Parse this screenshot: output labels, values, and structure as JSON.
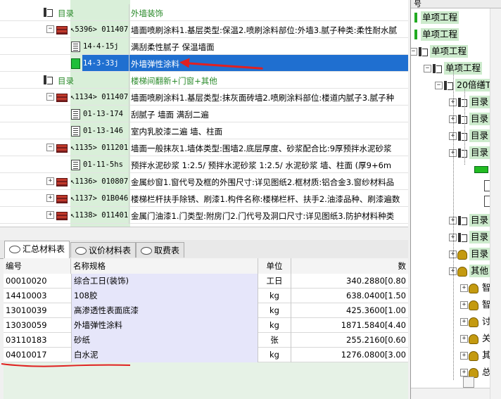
{
  "tree": {
    "rows": [
      {
        "kind": "dir",
        "expand": "",
        "code": "目录",
        "desc": "外墙装饰"
      },
      {
        "kind": "item",
        "expand": "−",
        "code": "↖5396> 011407",
        "desc": "墙面喷刷涂料1.基层类型:保温2.喷刷涂料部位:外墙3.腻子种类:柔性耐水腻"
      },
      {
        "kind": "sub",
        "code": "14-4-15j",
        "desc": "满刮柔性腻子 保温墙面"
      },
      {
        "kind": "sub",
        "code": "14-3-33j",
        "desc": "外墙弹性涂料",
        "selected": true
      },
      {
        "kind": "dir",
        "expand": "",
        "code": "目录",
        "desc": "楼梯间翻新+门窗+其他"
      },
      {
        "kind": "item",
        "expand": "−",
        "code": "↖1134> 011407",
        "desc": "墙面喷刷涂料1.基层类型:抹灰面砖墙2.喷刷涂料部位:楼道内腻子3.腻子种"
      },
      {
        "kind": "sub",
        "code": "01-13-174",
        "desc": "刮腻子 墙面 满刮二遍"
      },
      {
        "kind": "sub",
        "code": "01-13-146",
        "desc": "室内乳胶漆二遍 墙、柱面"
      },
      {
        "kind": "item",
        "expand": "−",
        "code": "↖1135> 011201",
        "desc": "墙面一般抹灰1.墙体类型:围墙2.底层厚度、砂浆配合比:9厚预拌水泥砂浆"
      },
      {
        "kind": "sub",
        "code": "01-11-5hs",
        "desc": "预拌水泥砂浆 1:2.5/ 预拌水泥砂浆 1:2.5/ 水泥砂浆 墙、柱面 (厚9+6m"
      },
      {
        "kind": "item",
        "expand": "+",
        "code": "↖1136> 010807",
        "desc": "金属纱窗1.窗代号及框的外围尺寸:详见图纸2.框材质:铝合金3.窗纱材料品"
      },
      {
        "kind": "item",
        "expand": "+",
        "code": "↖1137> 01B046",
        "desc": "楼梯栏杆扶手除锈、刷漆1.构件名称:楼梯栏杆、扶手2.油漆品种、刷漆遍数"
      },
      {
        "kind": "item",
        "expand": "+",
        "code": "↖1138> 011401",
        "desc": "金属门油漆1.门类型:附房门2.门代号及洞口尺寸:详见图纸3.防护材料种类"
      }
    ]
  },
  "tabs": [
    {
      "label": "汇总材料表",
      "active": true
    },
    {
      "label": "议价材料表",
      "active": false
    },
    {
      "label": "取费表",
      "active": false
    }
  ],
  "materials": {
    "headers": {
      "code": "编号",
      "name": "名称规格",
      "unit": "单位",
      "qty": "数"
    },
    "rows": [
      {
        "code": "00010020",
        "name": "综合工日(装饰)",
        "unit": "工日",
        "qty": "340.2880[0.80"
      },
      {
        "code": "14410003",
        "name": "108胶",
        "unit": "kg",
        "qty": "638.0400[1.50"
      },
      {
        "code": "13010039",
        "name": "高渗透性表面底漆",
        "unit": "kg",
        "qty": "425.3600[1.00"
      },
      {
        "code": "13030059",
        "name": "外墙弹性涂料",
        "unit": "kg",
        "qty": "1871.5840[4.40"
      },
      {
        "code": "03110183",
        "name": "砂纸",
        "unit": "张",
        "qty": "255.2160[0.60"
      },
      {
        "code": "04010017",
        "name": "白水泥",
        "unit": "kg",
        "qty": "1276.0800[3.00"
      }
    ]
  },
  "right_panel": {
    "header": "号",
    "items": [
      {
        "label": "单项工程",
        "marker": "green-bar"
      },
      {
        "label": "单项工程",
        "marker": "green-bar"
      },
      {
        "label": "单项工程",
        "marker": "folder"
      },
      {
        "label": "单项工程",
        "marker": "folder"
      },
      {
        "label": "20倍缮T",
        "marker": "folder"
      },
      {
        "label": "目录",
        "marker": "folder"
      },
      {
        "label": "目录",
        "marker": "folder"
      },
      {
        "label": "目录",
        "marker": "folder"
      },
      {
        "label": "目录",
        "marker": "folder"
      },
      {
        "label": "目录",
        "marker": "folder"
      },
      {
        "label": "目录",
        "marker": "folder"
      },
      {
        "label": "目录",
        "marker": "person"
      },
      {
        "label": "其他",
        "marker": "person"
      },
      {
        "label": "智",
        "marker": "person"
      },
      {
        "label": "智",
        "marker": "person"
      },
      {
        "label": "讨",
        "marker": "person"
      },
      {
        "label": "关",
        "marker": "person"
      },
      {
        "label": "其",
        "marker": "person"
      },
      {
        "label": "总",
        "marker": "person"
      }
    ]
  },
  "colors": {
    "selection": "#1f6fd0",
    "accent_green": "#22aa22",
    "annotation_red": "#e02020"
  }
}
